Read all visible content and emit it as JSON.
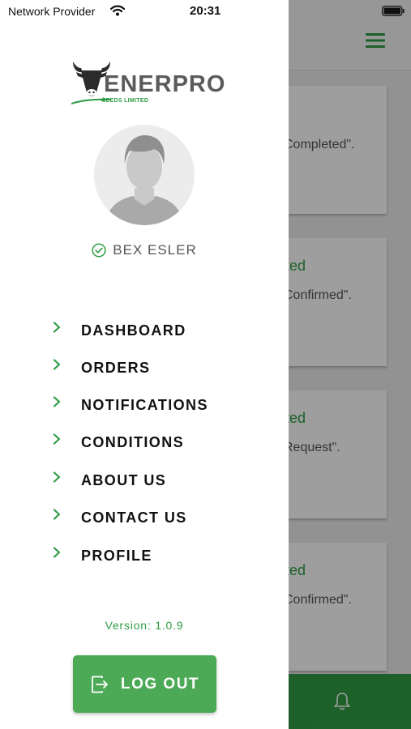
{
  "status_bar": {
    "carrier": "Network Provider",
    "time": "20:31"
  },
  "background_screen": {
    "cards": [
      {
        "status": "",
        "message": "Completed\"."
      },
      {
        "status": "ted",
        "message": "Confirmed\"."
      },
      {
        "status": "ted",
        "message": "Request\"."
      },
      {
        "status": "ted",
        "message": "Confirmed\"."
      }
    ]
  },
  "drawer": {
    "logo": {
      "brand": "ENERPRO",
      "subtitle": "FEEDS LIMITED"
    },
    "user": {
      "name": "BEX ESLER"
    },
    "nav": [
      {
        "label": "DASHBOARD"
      },
      {
        "label": "ORDERS"
      },
      {
        "label": "NOTIFICATIONS"
      },
      {
        "label": "CONDITIONS"
      },
      {
        "label": "ABOUT US"
      },
      {
        "label": "CONTACT US"
      },
      {
        "label": "PROFILE"
      }
    ],
    "version": "Version: 1.0.9",
    "logout_label": "LOG OUT"
  },
  "colors": {
    "accent": "#2f9c45",
    "logout_button": "#4caa57",
    "bottom_bar": "#2f9c45"
  },
  "icons": [
    "wifi-icon",
    "battery-icon",
    "menu-icon",
    "bell-icon",
    "verified-icon",
    "chevron-right-icon",
    "logout-icon"
  ]
}
